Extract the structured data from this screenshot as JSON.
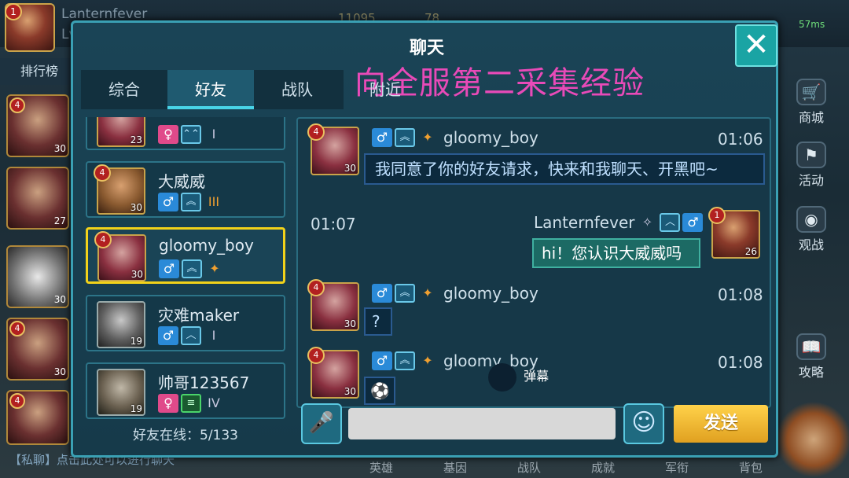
{
  "player": {
    "name": "Lanternfever",
    "level": "Lv.26",
    "badge": "1"
  },
  "resources": [
    "11095",
    "78"
  ],
  "signal": "57ms",
  "rank_button": "排行榜",
  "left_heroes": [
    {
      "badge": "4",
      "level": "30"
    },
    {
      "badge": "",
      "level": "27"
    },
    {
      "badge": "",
      "level": "30"
    },
    {
      "badge": "4",
      "level": "30"
    },
    {
      "badge": "4",
      "level": ""
    }
  ],
  "right_menu": [
    {
      "label": "商城",
      "icon": "shop-cart-icon"
    },
    {
      "label": "活动",
      "icon": "event-flag-icon"
    },
    {
      "label": "观战",
      "icon": "eye-icon"
    },
    {
      "label": "攻略",
      "icon": "book-icon"
    }
  ],
  "bottom_nav": [
    "英雄",
    "基因",
    "战队",
    "成就",
    "军衔",
    "背包"
  ],
  "private_tip": "【私聊】点击此处可以进行聊天",
  "dialog": {
    "title": "聊天",
    "close_symbol": "✕",
    "overlay": "向全服第二采集经验",
    "tabs": [
      "综合",
      "好友",
      "战队"
    ],
    "tab_more": "附近",
    "active_tab": "好友"
  },
  "friends": [
    {
      "name": "",
      "level": "23",
      "badge": "",
      "sex": "female",
      "rank": "I"
    },
    {
      "name": "大威威",
      "level": "30",
      "badge": "4",
      "sex": "male",
      "rank": "III"
    },
    {
      "name": "gloomy_boy",
      "level": "30",
      "badge": "4",
      "sex": "male",
      "rank": ""
    },
    {
      "name": "灾难maker",
      "level": "19",
      "badge": "",
      "sex": "male",
      "rank": "I"
    },
    {
      "name": "帅哥123567",
      "level": "19",
      "badge": "",
      "sex": "female",
      "rank": "IV"
    }
  ],
  "online": "好友在线：5/133",
  "messages": [
    {
      "sender": "gloomy_boy",
      "time": "01:06",
      "level": "30",
      "badge": "4",
      "text": "我同意了你的好友请求，快来和我聊天、开黑吧~"
    },
    {
      "sender": "Lanternfever",
      "time": "01:07",
      "level": "26",
      "badge": "1",
      "text": "hi！您认识大威威吗"
    },
    {
      "sender": "gloomy_boy",
      "time": "01:08",
      "level": "30",
      "badge": "4",
      "text": "?"
    },
    {
      "sender": "gloomy_boy",
      "time": "01:08",
      "level": "30",
      "badge": "4",
      "text": "⚽"
    }
  ],
  "danmu": "弹幕",
  "input": {
    "placeholder": "",
    "send_label": "发送"
  },
  "colors": {
    "accent": "#3aa0b4",
    "selected_border": "#f2d21a",
    "send": "#e0a020",
    "overlay": "#e84ab8"
  }
}
